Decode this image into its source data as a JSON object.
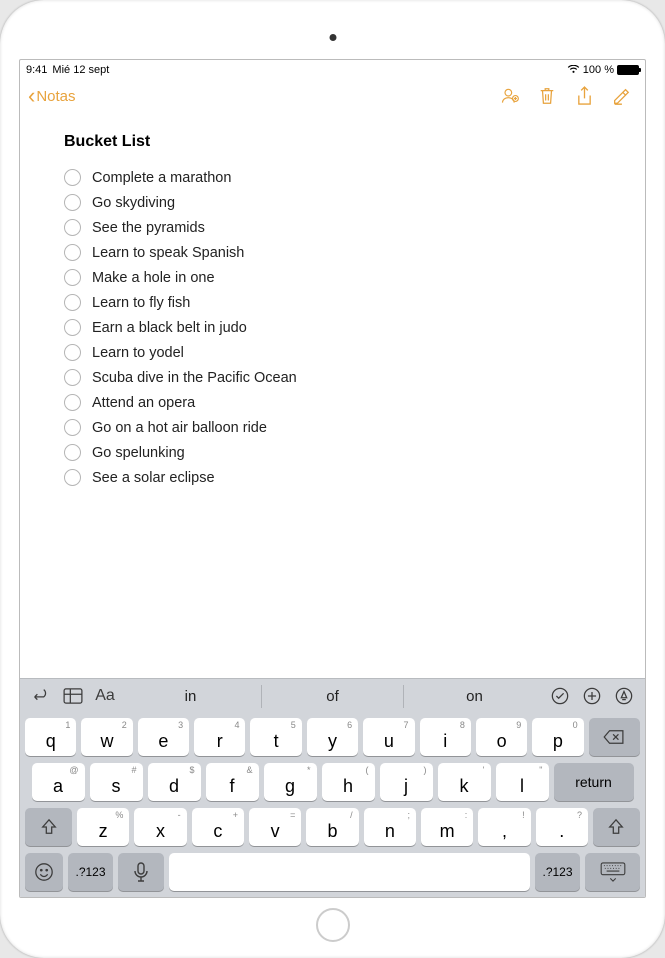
{
  "status": {
    "time": "9:41",
    "date": "Mié 12 sept",
    "battery": "100 %"
  },
  "nav": {
    "back_label": "Notas"
  },
  "note": {
    "title": "Bucket List",
    "items": [
      "Complete a marathon",
      "Go skydiving",
      "See the pyramids",
      "Learn to speak Spanish",
      "Make a hole in one",
      "Learn to fly fish",
      "Earn a black belt in judo",
      "Learn to yodel",
      "Scuba dive in the Pacific Ocean",
      "Attend an opera",
      "Go on a hot air balloon ride",
      "Go spelunking",
      "See a solar eclipse"
    ]
  },
  "keyboard": {
    "suggestions": [
      "in",
      "of",
      "on"
    ],
    "row1": [
      {
        "k": "q",
        "s": "1"
      },
      {
        "k": "w",
        "s": "2"
      },
      {
        "k": "e",
        "s": "3"
      },
      {
        "k": "r",
        "s": "4"
      },
      {
        "k": "t",
        "s": "5"
      },
      {
        "k": "y",
        "s": "6"
      },
      {
        "k": "u",
        "s": "7"
      },
      {
        "k": "i",
        "s": "8"
      },
      {
        "k": "o",
        "s": "9"
      },
      {
        "k": "p",
        "s": "0"
      }
    ],
    "row2": [
      {
        "k": "a",
        "s": "@"
      },
      {
        "k": "s",
        "s": "#"
      },
      {
        "k": "d",
        "s": "$"
      },
      {
        "k": "f",
        "s": "&"
      },
      {
        "k": "g",
        "s": "*"
      },
      {
        "k": "h",
        "s": "("
      },
      {
        "k": "j",
        "s": ")"
      },
      {
        "k": "k",
        "s": "'"
      },
      {
        "k": "l",
        "s": "\""
      }
    ],
    "return_label": "return",
    "row3": [
      {
        "k": "z",
        "s": "%"
      },
      {
        "k": "x",
        "s": "-"
      },
      {
        "k": "c",
        "s": "+"
      },
      {
        "k": "v",
        "s": "="
      },
      {
        "k": "b",
        "s": "/"
      },
      {
        "k": "n",
        "s": ";"
      },
      {
        "k": "m",
        "s": ":"
      },
      {
        "k": ",",
        "s": "!"
      },
      {
        "k": ".",
        "s": "?"
      }
    ],
    "numkey_label": ".?123"
  }
}
